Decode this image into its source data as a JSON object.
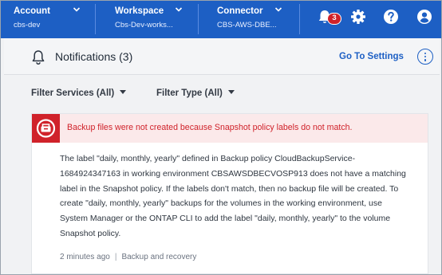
{
  "topbar": {
    "account": {
      "label": "Account",
      "value": "cbs-dev"
    },
    "workspace": {
      "label": "Workspace",
      "value": "Cbs-Dev-works..."
    },
    "connector": {
      "label": "Connector",
      "value": "CBS-AWS-DBE..."
    },
    "notification_count": "3",
    "icons": [
      "bell-icon",
      "gear-icon",
      "help-icon",
      "user-icon"
    ]
  },
  "panel": {
    "title": "Notifications (3)",
    "go_to_settings": "Go To Settings",
    "filters": {
      "services": "Filter Services (All)",
      "type": "Filter Type (All)"
    }
  },
  "notification": {
    "headline": "Backup files were not created because Snapshot policy labels do not match.",
    "body": "The label \"daily, monthly, yearly\" defined in Backup policy CloudBackupService-1684924347163 in working environment CBSAWSDBECVOSP913 does not have a matching label in the Snapshot policy. If the labels don't match, then no backup file will be created. To create \"daily, monthly, yearly\" backups for the volumes in the working environment, use System Manager or the ONTAP CLI to add the label \"daily, monthly, yearly\" to the volume Snapshot policy.",
    "time": "2 minutes ago",
    "source": "Backup and recovery"
  },
  "colors": {
    "brand_blue": "#1d5fc4",
    "alert_red": "#d0222a",
    "alert_bg": "#fbe9ea"
  }
}
